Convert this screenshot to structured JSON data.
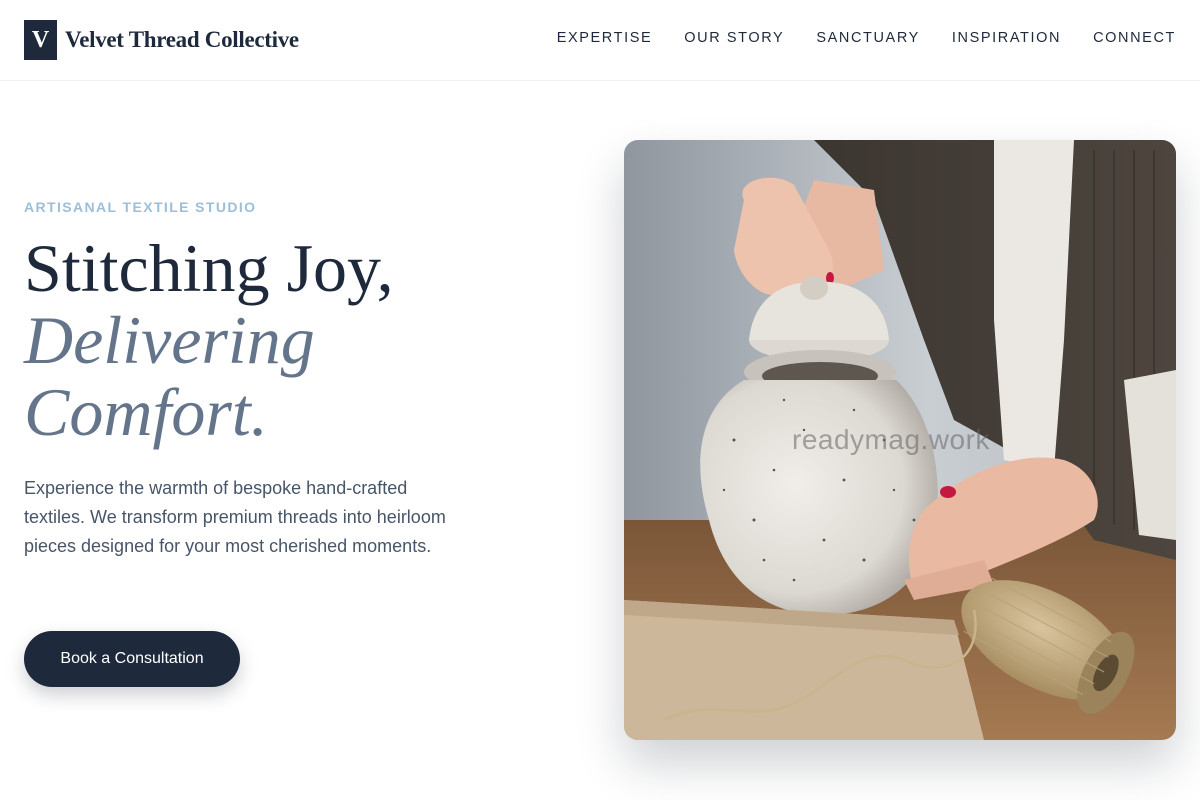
{
  "brand": {
    "mark": "V",
    "name": "Velvet Thread Collective"
  },
  "nav": [
    {
      "label": "EXPERTISE"
    },
    {
      "label": "OUR STORY"
    },
    {
      "label": "SANCTUARY"
    },
    {
      "label": "INSPIRATION"
    },
    {
      "label": "CONNECT"
    }
  ],
  "hero": {
    "eyebrow": "ARTISANAL TEXTILE STUDIO",
    "headline_1": "Stitching Joy,",
    "headline_2": "Delivering",
    "headline_3": "Comfort.",
    "lead": "Experience the warmth of bespoke hand-crafted textiles. We transform premium threads into heirloom pieces designed for your most cherished moments.",
    "cta_label": "Book a Consultation",
    "image_watermark": "readymag.work"
  },
  "colors": {
    "primary": "#1e293b",
    "accent_text": "#64748b",
    "eyebrow": "#9cbfd9"
  }
}
